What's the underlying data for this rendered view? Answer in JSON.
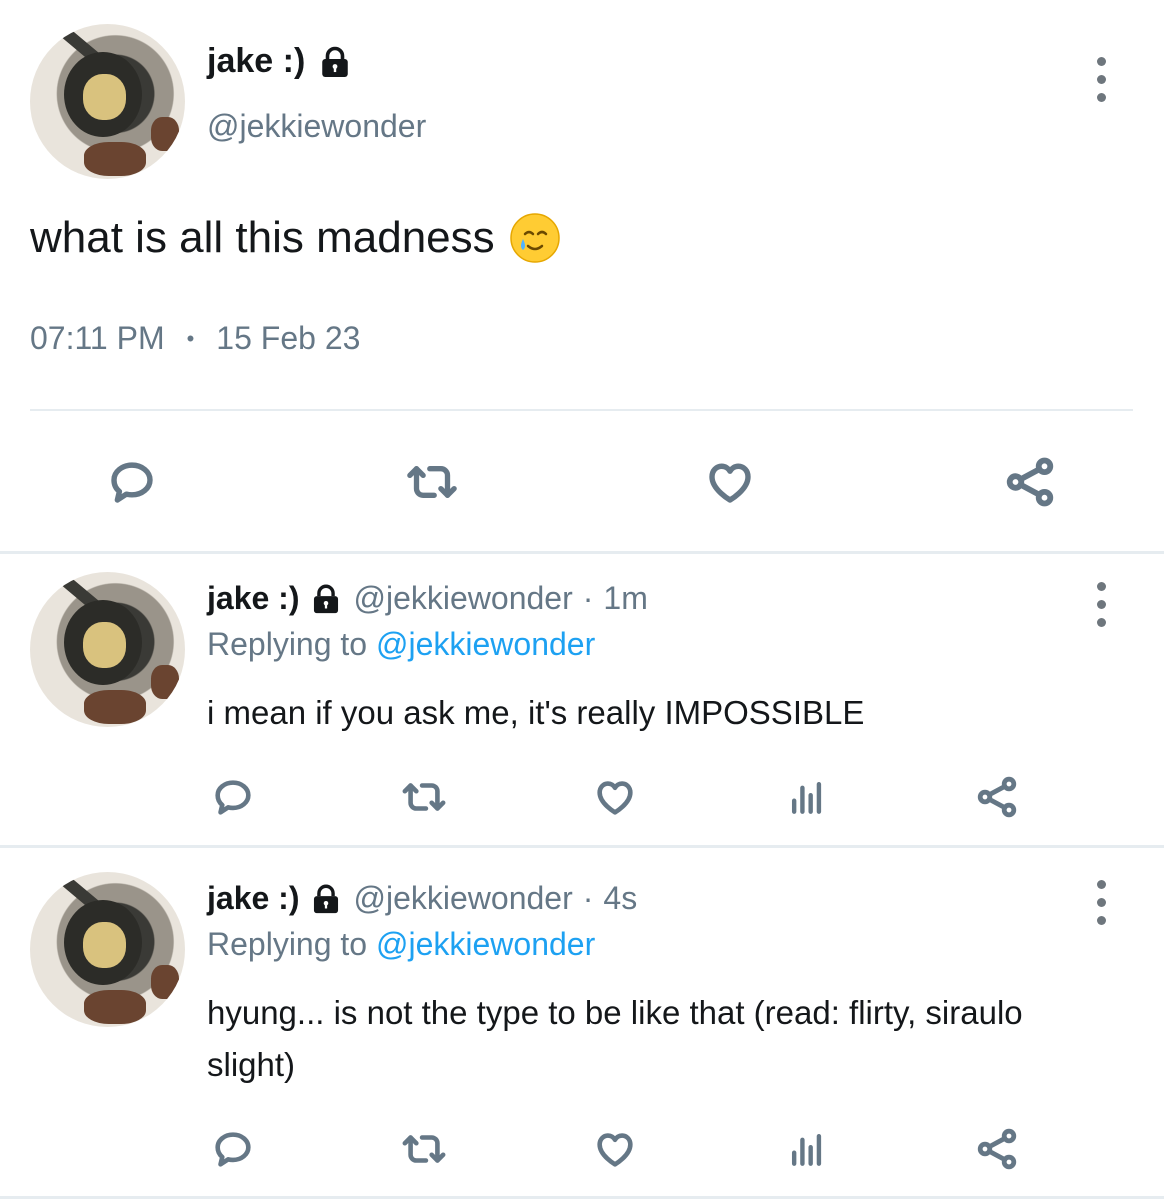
{
  "main_tweet": {
    "display_name": "jake :)",
    "handle": "@jekkiewonder",
    "text": "what is all this madness",
    "emoji": "🥲",
    "time": "07:11 PM",
    "separator": "•",
    "date": "15 Feb 23",
    "icons": [
      "lock-icon",
      "more-icon",
      "reply-icon",
      "retweet-icon",
      "like-icon",
      "share-icon"
    ]
  },
  "replies": [
    {
      "display_name": "jake :)",
      "handle": "@jekkiewonder",
      "dot": "·",
      "age": "1m",
      "replying_label": "Replying to",
      "replying_to": "@jekkiewonder",
      "text": "i mean if you ask me, it's really IMPOSSIBLE"
    },
    {
      "display_name": "jake :)",
      "handle": "@jekkiewonder",
      "dot": "·",
      "age": "4s",
      "replying_label": "Replying to",
      "replying_to": "@jekkiewonder",
      "text": "hyung... is not the type to be like that (read: flirty, siraulo slight)"
    }
  ],
  "colors": {
    "text": "#14171a",
    "secondary": "#657786",
    "link": "#1da1f2",
    "divider": "#e6ecf0"
  }
}
